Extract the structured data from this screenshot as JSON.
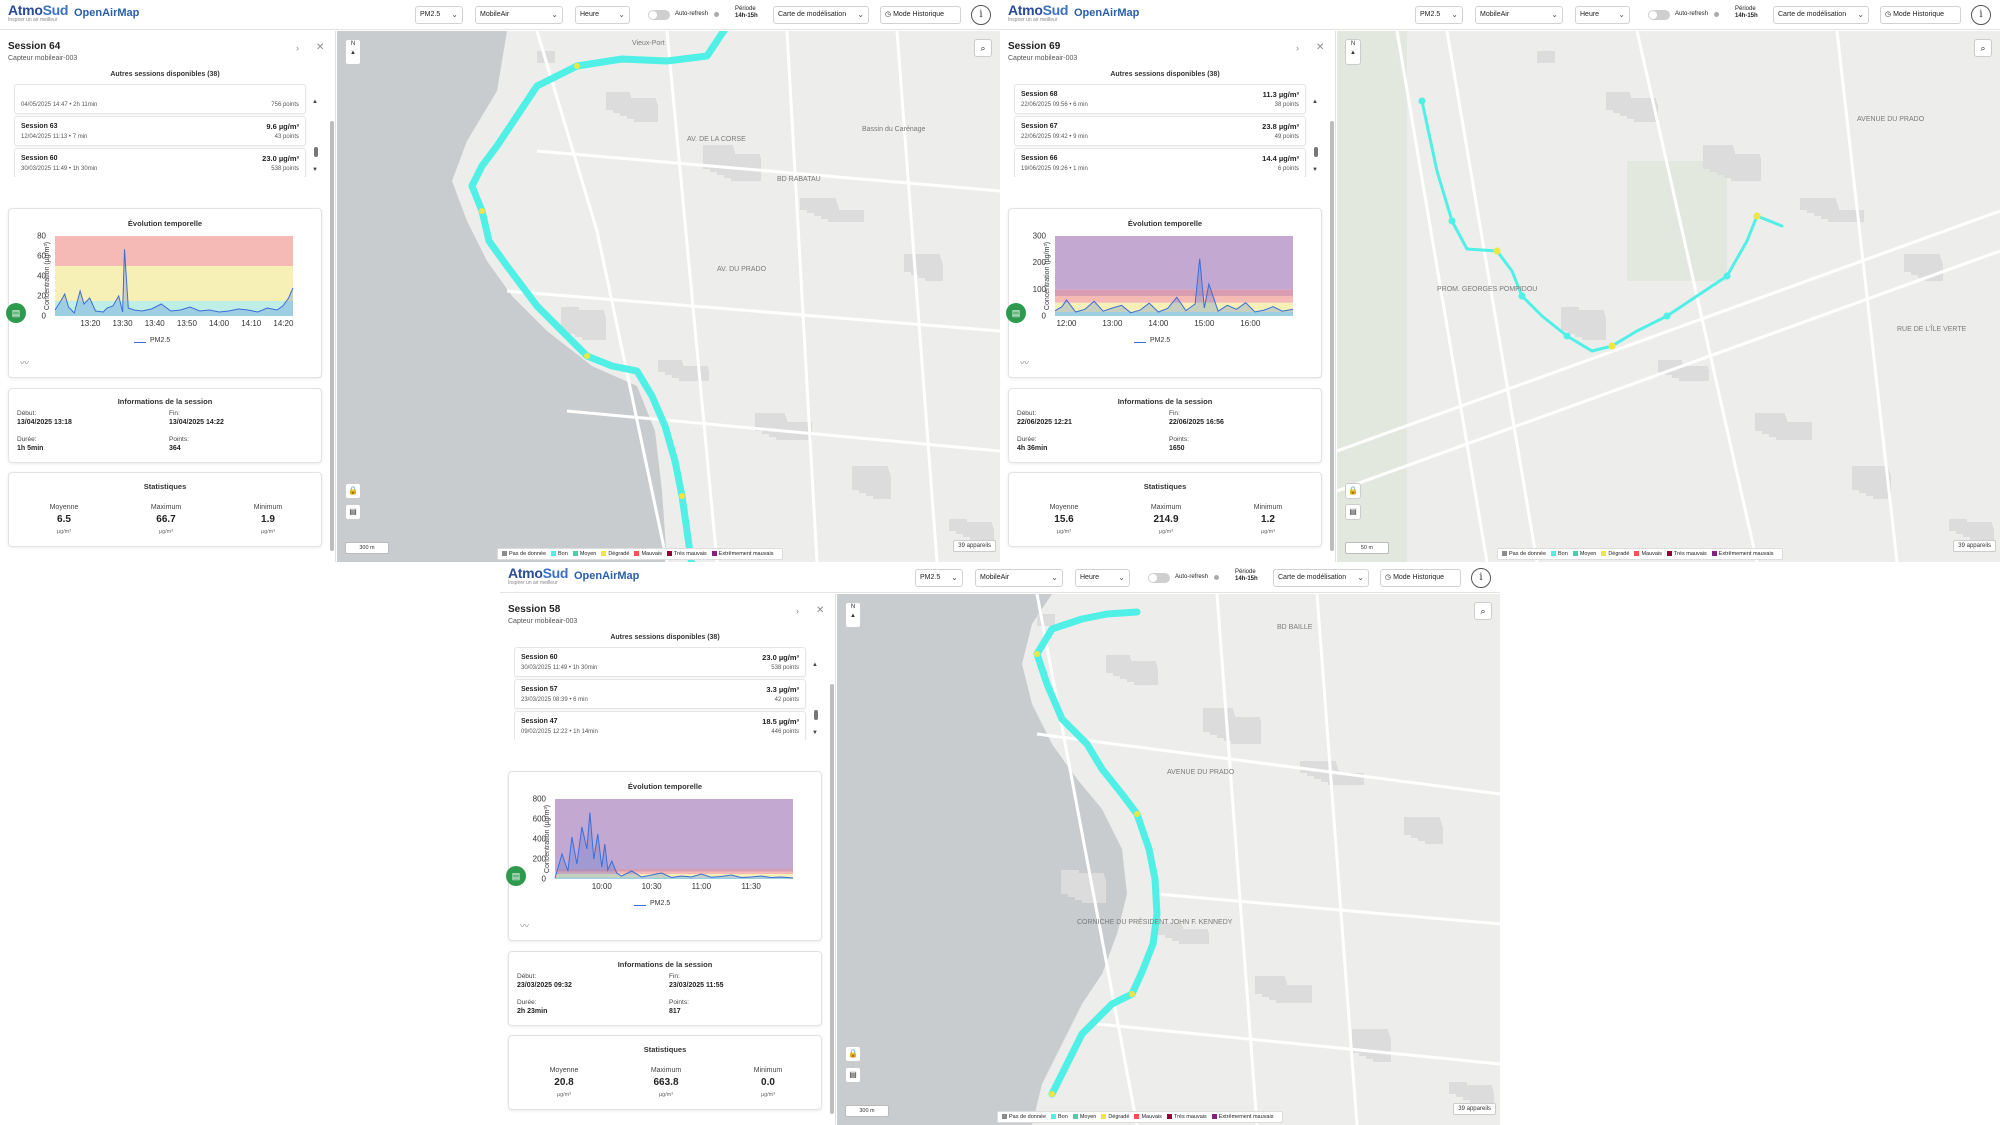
{
  "shared": {
    "logo_atmo": "Atmo",
    "logo_sud": "Sud",
    "logo_tagline": "Inspirer un air meilleur",
    "app_title": "OpenAirMap",
    "pollutant": "PM2.5",
    "device_type": "MobileAir",
    "time_step": "Heure",
    "auto_refresh": "Auto-refresh",
    "periode_label": "Période",
    "periode_value": "14h-15h",
    "model_map": "Carte de modélisation",
    "history_mode": "Mode Historique",
    "sensor": "Capteur mobileair-003",
    "other_sessions_title": "Autres sessions disponibles (38)",
    "chart_title": "Évolution temporelle",
    "chart_ylabel": "Concentration (µg/m³)",
    "chart_legend": "PM2.5",
    "info_title": "Informations de la session",
    "label_start": "Début:",
    "label_end": "Fin:",
    "label_duration": "Durée:",
    "label_points": "Points:",
    "stats_title": "Statistiques",
    "label_mean": "Moyenne",
    "label_max": "Maximum",
    "label_min": "Minimum",
    "unit": "µg/m³",
    "devices_count": "39 appareils",
    "legend": [
      {
        "label": "Pas de donnée",
        "color": "#8c8c8c"
      },
      {
        "label": "Bon",
        "color": "#50f0e6"
      },
      {
        "label": "Moyen",
        "color": "#50ccaa"
      },
      {
        "label": "Dégradé",
        "color": "#f0e641"
      },
      {
        "label": "Mauvais",
        "color": "#ff5050"
      },
      {
        "label": "Très mauvais",
        "color": "#960032"
      },
      {
        "label": "Extrêmement mauvais",
        "color": "#872181"
      }
    ]
  },
  "screens": [
    {
      "session_title": "Session 64",
      "other_sessions": [
        {
          "name": "",
          "meta": "04/05/2025 14:47 • 2h 11min",
          "value": "",
          "points": "756 points"
        },
        {
          "name": "Session 63",
          "meta": "12/04/2025 11:13 • 7 min",
          "value": "9.6 µg/m³",
          "points": "43 points"
        },
        {
          "name": "Session 60",
          "meta": "30/03/2025 11:49 • 1h 30min",
          "value": "23.0 µg/m³",
          "points": "538 points"
        }
      ],
      "info": {
        "start": "13/04/2025 13:18",
        "end": "13/04/2025 14:22",
        "duration": "1h 5min",
        "points": "364"
      },
      "stats": {
        "mean": "6.5",
        "max": "66.7",
        "min": "1.9"
      },
      "scale": "300 m",
      "map_labels": [
        "Vieux-Port",
        "AV. DE LA CORSE",
        "BD RABATAU",
        "AV. DU PRADO",
        "Bassin du Carénage"
      ],
      "chart_data": {
        "type": "line",
        "title": "Évolution temporelle",
        "ylabel": "Concentration (µg/m³)",
        "ylim": [
          0,
          80
        ],
        "yticks": [
          0,
          20,
          40,
          60,
          80
        ],
        "xlim": [
          13.15,
          14.383
        ],
        "xticks": [
          "13:20",
          "13:30",
          "13:40",
          "13:50",
          "14:00",
          "14:10",
          "14:20"
        ],
        "bands": [
          {
            "from": 0,
            "to": 15,
            "color": "#bfeee6"
          },
          {
            "from": 15,
            "to": 50,
            "color": "#f6efb6"
          },
          {
            "from": 50,
            "to": 80,
            "color": "#f5b9b6"
          }
        ],
        "series": [
          {
            "name": "PM2.5",
            "color": "#3a6fd8",
            "x": [
              13.15,
              13.18,
              13.2,
              13.22,
              13.25,
              13.28,
              13.3,
              13.33,
              13.36,
              13.4,
              13.42,
              13.45,
              13.48,
              13.5,
              13.51,
              13.53,
              13.56,
              13.6,
              13.65,
              13.7,
              13.75,
              13.8,
              13.85,
              13.9,
              13.95,
              14.0,
              14.05,
              14.1,
              14.15,
              14.2,
              14.25,
              14.3,
              14.33,
              14.36,
              14.383
            ],
            "values": [
              6,
              15,
              22,
              9,
              3,
              25,
              12,
              18,
              5,
              4,
              8,
              10,
              20,
              4,
              66.7,
              8,
              6,
              5,
              7,
              12,
              5,
              6,
              9,
              5,
              6,
              4,
              5,
              7,
              6,
              4,
              8,
              6,
              10,
              18,
              28
            ]
          }
        ]
      }
    },
    {
      "session_title": "Session 69",
      "other_sessions": [
        {
          "name": "Session 68",
          "meta": "22/06/2025 09:56 • 6 min",
          "value": "11.3 µg/m³",
          "points": "38 points"
        },
        {
          "name": "Session 67",
          "meta": "22/06/2025 09:42 • 9 min",
          "value": "23.8 µg/m³",
          "points": "49 points"
        },
        {
          "name": "Session 66",
          "meta": "19/06/2025 09:26 • 1 min",
          "value": "14.4 µg/m³",
          "points": "6 points"
        }
      ],
      "info": {
        "start": "22/06/2025 12:21",
        "end": "22/06/2025 16:56",
        "duration": "4h 36min",
        "points": "1650"
      },
      "stats": {
        "mean": "15.6",
        "max": "214.9",
        "min": "1.2"
      },
      "scale": "50 m",
      "map_labels": [
        "AVENUE DU PRADO",
        "PROM. GEORGES POMPIDOU",
        "RUE DE L'ÎLE VERTE"
      ],
      "chart_data": {
        "type": "line",
        "title": "Évolution temporelle",
        "ylabel": "Concentration (µg/m³)",
        "ylim": [
          0,
          300
        ],
        "yticks": [
          0,
          100,
          200,
          300
        ],
        "xlim": [
          11.75,
          16.93
        ],
        "xticks": [
          "12:00",
          "13:00",
          "14:00",
          "15:00",
          "16:00"
        ],
        "bands": [
          {
            "from": 0,
            "to": 15,
            "color": "#bfeee6"
          },
          {
            "from": 15,
            "to": 50,
            "color": "#f6efb6"
          },
          {
            "from": 50,
            "to": 75,
            "color": "#f5b9b6"
          },
          {
            "from": 75,
            "to": 100,
            "color": "#d89db1"
          },
          {
            "from": 100,
            "to": 300,
            "color": "#c3a8d1"
          }
        ],
        "series": [
          {
            "name": "PM2.5",
            "color": "#3a6fd8",
            "x": [
              11.75,
              11.9,
              12.0,
              12.2,
              12.4,
              12.6,
              12.8,
              13.0,
              13.2,
              13.4,
              13.6,
              13.8,
              14.0,
              14.2,
              14.4,
              14.6,
              14.8,
              14.9,
              15.0,
              15.1,
              15.3,
              15.5,
              15.7,
              15.9,
              16.1,
              16.3,
              16.5,
              16.7,
              16.93
            ],
            "values": [
              20,
              35,
              60,
              15,
              25,
              55,
              18,
              30,
              40,
              12,
              22,
              48,
              15,
              28,
              70,
              20,
              45,
              214.9,
              30,
              120,
              18,
              40,
              25,
              50,
              15,
              22,
              35,
              18,
              25
            ]
          }
        ]
      }
    },
    {
      "session_title": "Session 58",
      "other_sessions": [
        {
          "name": "Session 60",
          "meta": "30/03/2025 11:49 • 1h 30min",
          "value": "23.0 µg/m³",
          "points": "538 points"
        },
        {
          "name": "Session 57",
          "meta": "23/03/2025 08:39 • 6 min",
          "value": "3.3 µg/m³",
          "points": "42 points"
        },
        {
          "name": "Session 47",
          "meta": "09/02/2025 12:22 • 1h 14min",
          "value": "18.5 µg/m³",
          "points": "446 points"
        }
      ],
      "info": {
        "start": "23/03/2025 09:32",
        "end": "23/03/2025 11:55",
        "duration": "2h 23min",
        "points": "817"
      },
      "stats": {
        "mean": "20.8",
        "max": "663.8",
        "min": "0.0"
      },
      "scale": "300 m",
      "map_labels": [
        "BD BAILLE",
        "AVENUE DU PRADO",
        "CORNICHE DU PRÉSIDENT JOHN F. KENNEDY"
      ],
      "chart_data": {
        "type": "line",
        "title": "Évolution temporelle",
        "ylabel": "Concentration (µg/m³)",
        "ylim": [
          0,
          800
        ],
        "yticks": [
          0,
          200,
          400,
          600,
          800
        ],
        "xlim": [
          9.53,
          11.92
        ],
        "xticks": [
          "10:00",
          "10:30",
          "11:00",
          "11:30"
        ],
        "bands": [
          {
            "from": 0,
            "to": 15,
            "color": "#bfeee6"
          },
          {
            "from": 15,
            "to": 50,
            "color": "#f6efb6"
          },
          {
            "from": 50,
            "to": 75,
            "color": "#f5b9b6"
          },
          {
            "from": 75,
            "to": 100,
            "color": "#d89db1"
          },
          {
            "from": 100,
            "to": 800,
            "color": "#c3a8d1"
          }
        ],
        "series": [
          {
            "name": "PM2.5",
            "color": "#3a6fd8",
            "x": [
              9.53,
              9.6,
              9.66,
              9.7,
              9.75,
              9.8,
              9.85,
              9.88,
              9.92,
              9.96,
              10.0,
              10.03,
              10.06,
              10.1,
              10.15,
              10.2,
              10.3,
              10.4,
              10.5,
              10.6,
              10.7,
              10.8,
              10.9,
              11.0,
              11.1,
              11.2,
              11.3,
              11.4,
              11.5,
              11.6,
              11.7,
              11.8,
              11.92
            ],
            "values": [
              10,
              250,
              80,
              420,
              150,
              520,
              300,
              663.8,
              200,
              450,
              120,
              350,
              90,
              180,
              60,
              30,
              80,
              20,
              40,
              60,
              15,
              30,
              20,
              50,
              18,
              25,
              40,
              15,
              20,
              30,
              15,
              20,
              10
            ]
          }
        ]
      }
    }
  ]
}
